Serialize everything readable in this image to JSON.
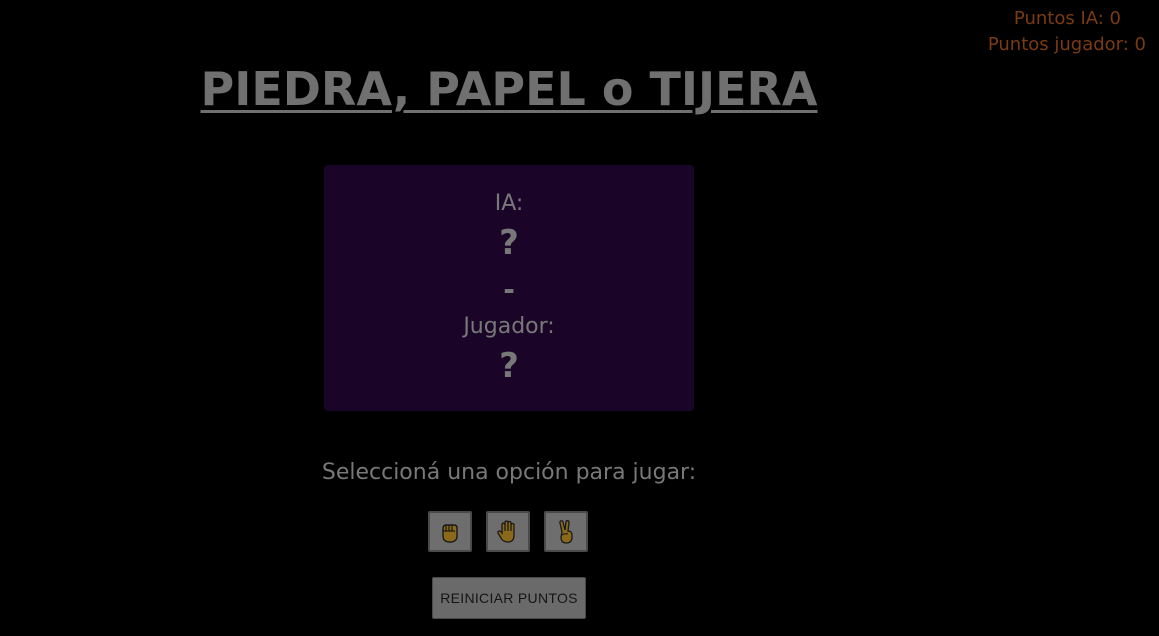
{
  "scoreboard": {
    "ia_score": "Puntos IA: 0",
    "player_score": "Puntos jugador: 0"
  },
  "title": "PIEDRA, PAPEL o TIJERA",
  "panel": {
    "ia_label": "IA:",
    "ia_choice": "?",
    "separator": "-",
    "player_label": "Jugador:",
    "player_choice": "?"
  },
  "instructions": "Seleccioná una opción para jugar:",
  "options": [
    {
      "name": "piedra",
      "icon": "raised-fist-icon"
    },
    {
      "name": "papel",
      "icon": "raised-hand-icon"
    },
    {
      "name": "tijera",
      "icon": "victory-hand-icon"
    }
  ],
  "reset_label": "REINICIAR PUNTOS",
  "colors": {
    "background": "#000000",
    "panel": "#1a0529",
    "score_text": "#7a3a12",
    "text": "#787878",
    "emoji_skin": "#8a6a1a"
  }
}
